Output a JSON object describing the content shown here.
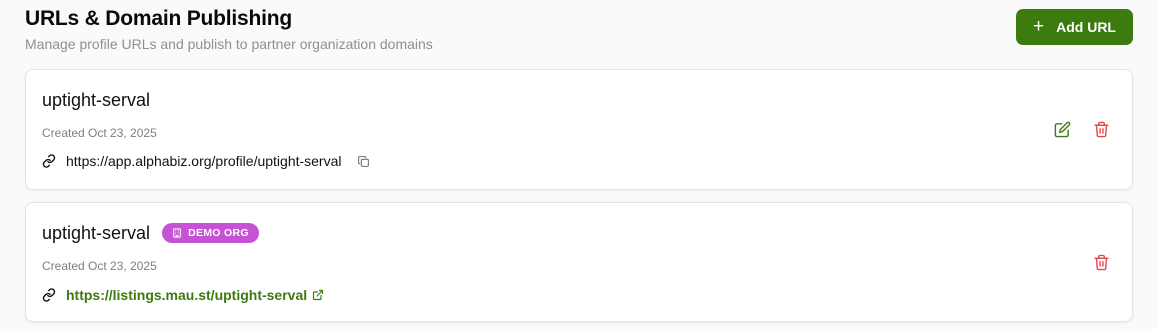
{
  "header": {
    "title": "URLs & Domain Publishing",
    "subtitle": "Manage profile URLs and publish to partner organization domains",
    "add_button_label": "Add URL"
  },
  "colors": {
    "accent": "#3d7a0f",
    "badge": "#c653d6",
    "delete": "#e5484d"
  },
  "urls": [
    {
      "name": "uptight-serval",
      "created": "Created Oct 23, 2025",
      "url": "https://app.alphabiz.org/profile/uptight-serval",
      "icons": [
        "link-icon",
        "copy-icon",
        "edit-icon",
        "trash-icon"
      ]
    },
    {
      "name": "uptight-serval",
      "badge": "DEMO ORG",
      "created": "Created Oct 23, 2025",
      "url": "https://listings.mau.st/uptight-serval",
      "icons": [
        "link-icon",
        "external-link-icon",
        "building-icon",
        "trash-icon"
      ]
    }
  ]
}
